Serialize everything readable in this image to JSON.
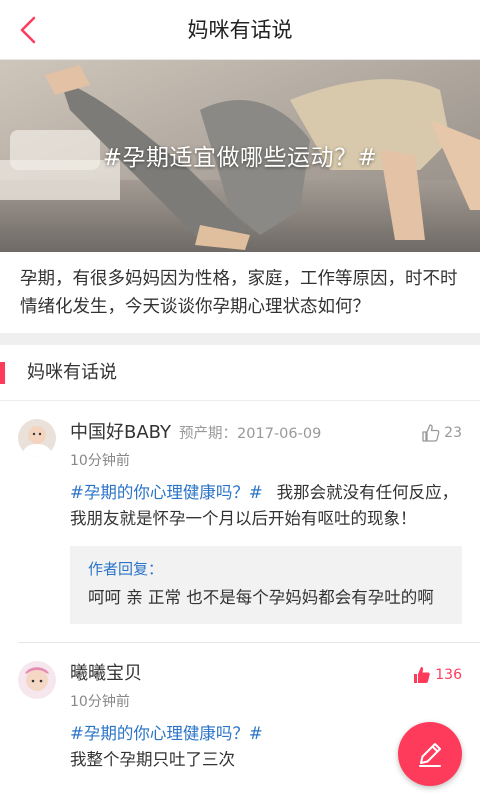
{
  "header": {
    "title": "妈咪有话说"
  },
  "banner": {
    "text": "#孕期适宜做哪些运动？#"
  },
  "intro": "孕期，有很多妈妈因为性格，家庭，工作等原因，时不时情绪化发生，今天谈谈你孕期心理状态如何？",
  "section": {
    "title": "妈咪有话说"
  },
  "comments": [
    {
      "name": "中国好BABY",
      "due": "预产期：2017-06-09",
      "time": "10分钟前",
      "likes": "23",
      "topic": "#孕期的你心理健康吗？#",
      "text": "我那会就没有任何反应，我朋友就是怀孕一个月以后开始有呕吐的现象！",
      "reply_label": "作者回复：",
      "reply_text": "呵呵 亲 正常 也不是每个孕妈妈都会有孕吐的啊"
    },
    {
      "name": "曦曦宝贝",
      "time": "10分钟前",
      "likes": "136",
      "topic": "#孕期的你心理健康吗？#",
      "text": "我整个孕期只吐了三次"
    }
  ],
  "colors": {
    "accent": "#ff3b5c",
    "link": "#2b74c7"
  },
  "icons": {
    "back": "chevron-left-icon",
    "like": "thumbs-up-icon",
    "compose": "pencil-icon"
  }
}
